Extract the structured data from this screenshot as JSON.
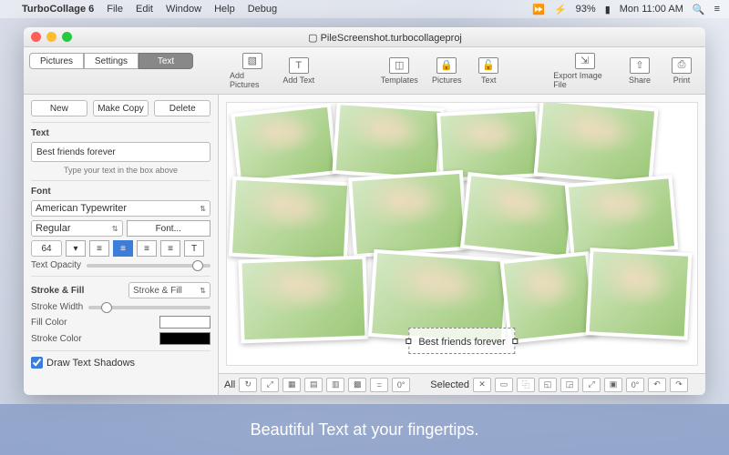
{
  "menubar": {
    "app": "TurboCollage 6",
    "items": [
      "File",
      "Edit",
      "Window",
      "Help",
      "Debug"
    ],
    "battery": "93%",
    "clock": "Mon 11:00 AM"
  },
  "window": {
    "filename": "PileScreenshot.turbocollageproj",
    "tabs": {
      "pictures": "Pictures",
      "settings": "Settings",
      "text": "Text"
    },
    "toolbar": {
      "addPictures": "Add Pictures",
      "addText": "Add Text",
      "templates": "Templates",
      "lockPictures": "Pictures",
      "lockText": "Text",
      "export": "Export Image File",
      "share": "Share",
      "print": "Print"
    }
  },
  "side": {
    "new": "New",
    "makeCopy": "Make Copy",
    "delete": "Delete",
    "textHeading": "Text",
    "textValue": "Best friends forever",
    "textHint": "Type your text in the box above",
    "fontHeading": "Font",
    "fontName": "American Typewriter",
    "fontStyle": "Regular",
    "fontMore": "Font...",
    "fontSize": "64",
    "opacityLabel": "Text Opacity",
    "strokeHeading": "Stroke & Fill",
    "strokeMode": "Stroke & Fill",
    "strokeWidthLabel": "Stroke Width",
    "fillColorLabel": "Fill Color",
    "strokeColorLabel": "Stroke Color",
    "fillColor": "#ffffff",
    "strokeColor": "#000000",
    "shadowCheck": "Draw Text Shadows"
  },
  "canvas": {
    "overlayText": "Best friends forever",
    "bottom": {
      "all": "All",
      "selected": "Selected"
    }
  },
  "caption": "Beautiful Text at your fingertips."
}
